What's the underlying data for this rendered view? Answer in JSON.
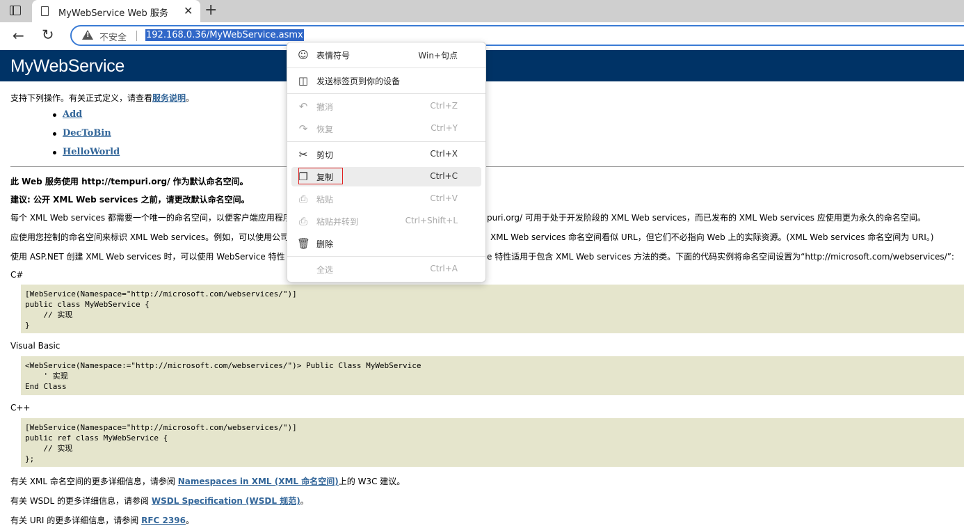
{
  "browser": {
    "tab_title": "MyWebService Web 服务",
    "tab_close": "✕",
    "new_tab": "+",
    "insecure_label": "不安全",
    "url": "192.168.0.36/MyWebService.asmx"
  },
  "page": {
    "title": "MyWebService",
    "intro_prefix": "支持下列操作。有关正式定义，请查看",
    "intro_link": "服务说明",
    "intro_suffix": "。",
    "operations": [
      "Add",
      "DecToBin",
      "HelloWorld"
    ],
    "ns_heading": "此 Web 服务使用 http://tempuri.org/ 作为默认命名空间。",
    "ns_advice": "建议: 公开 XML Web services 之前，请更改默认命名空间。",
    "para1_left": "每个 XML Web services 都需要一个唯一的命名空间，以便客户端应用程序",
    "para1_right": "puri.org/ 可用于处于开发阶段的 XML Web services，而已发布的 XML Web services 应使用更为永久的命名空间。",
    "para2_left": "应使用您控制的命名空间来标识 XML Web services。例如，可以使用公司",
    "para2_right": "XML Web services 命名空间看似 URL，但它们不必指向 Web 上的实际资源。(XML Web services 命名空间为 URI。)",
    "para3_left": "使用 ASP.NET 创建 XML Web services 时，可以使用 WebService 特性",
    "para3_right": "e 特性适用于包含 XML Web services 方法的类。下面的代码实例将命名空间设置为“http://microsoft.com/webservices/”:",
    "lang_cs": "C#",
    "code_cs": "[WebService(Namespace=\"http://microsoft.com/webservices/\")]\npublic class MyWebService {\n    // 实现\n}",
    "lang_vb": "Visual Basic",
    "code_vb": "<WebService(Namespace:=\"http://microsoft.com/webservices/\")> Public Class MyWebService\n    ' 实现\nEnd Class",
    "lang_cpp": "C++",
    "code_cpp": "[WebService(Namespace=\"http://microsoft.com/webservices/\")]\npublic ref class MyWebService {\n    // 实现\n};",
    "ref1_prefix": "有关 XML 命名空间的更多详细信息，请参阅 ",
    "ref1_link": "Namespaces in XML (XML 命名空间)",
    "ref1_suffix": "上的 W3C 建议。",
    "ref2_prefix": "有关 WSDL 的更多详细信息，请参阅 ",
    "ref2_link": "WSDL Specification (WSDL 规范)",
    "ref2_suffix": "。",
    "ref3_prefix": "有关 URI 的更多详细信息，请参阅 ",
    "ref3_link": "RFC 2396",
    "ref3_suffix": "。"
  },
  "context_menu": {
    "items": [
      {
        "label": "表情符号",
        "shortcut": "Win+句点",
        "icon": "emoji-icon",
        "enabled": true
      },
      {
        "label": "发送标签页到你的设备",
        "shortcut": "",
        "icon": "send-device-icon",
        "enabled": true
      },
      {
        "label": "撤消",
        "shortcut": "Ctrl+Z",
        "icon": "undo-icon",
        "enabled": false
      },
      {
        "label": "恢复",
        "shortcut": "Ctrl+Y",
        "icon": "redo-icon",
        "enabled": false
      },
      {
        "label": "剪切",
        "shortcut": "Ctrl+X",
        "icon": "scissors-icon",
        "enabled": true
      },
      {
        "label": "复制",
        "shortcut": "Ctrl+C",
        "icon": "copy-icon",
        "enabled": true,
        "highlighted": true
      },
      {
        "label": "粘贴",
        "shortcut": "Ctrl+V",
        "icon": "paste-icon",
        "enabled": false
      },
      {
        "label": "粘贴并转到",
        "shortcut": "Ctrl+Shift+L",
        "icon": "paste-go-icon",
        "enabled": false
      },
      {
        "label": "删除",
        "shortcut": "",
        "icon": "trash-icon",
        "enabled": true
      },
      {
        "label": "全选",
        "shortcut": "Ctrl+A",
        "icon": "",
        "enabled": false
      }
    ]
  },
  "colors": {
    "banner": "#003366",
    "link": "#336699",
    "code_bg": "#e5e5cc",
    "url_highlight": "#3067c8",
    "focus_ring": "#e02020"
  }
}
